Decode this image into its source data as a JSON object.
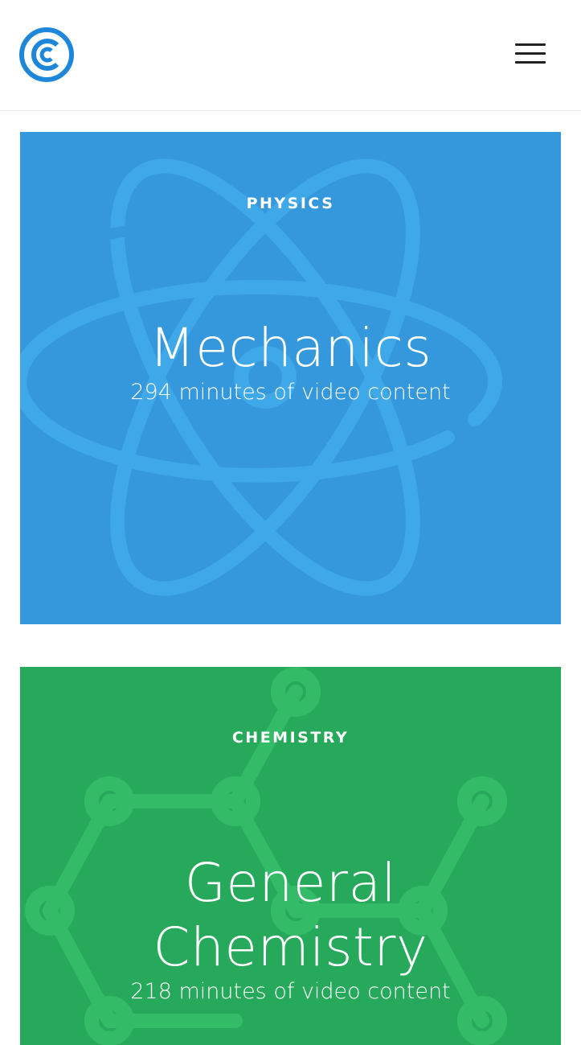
{
  "header": {
    "logo_icon": "c-logo-icon",
    "menu_icon": "hamburger-menu-icon"
  },
  "colors": {
    "brand_blue": "#1f87d9",
    "physics_bg": "#3698dc",
    "physics_art": "#3fa8e8",
    "chemistry_bg": "#27a95b",
    "chemistry_art": "#34bb67"
  },
  "courses": [
    {
      "category": "PHYSICS",
      "title": "Mechanics",
      "subtitle": "294 minutes of video content",
      "background_icon": "atom-icon"
    },
    {
      "category": "CHEMISTRY",
      "title_lines": [
        "General",
        "Chemistry"
      ],
      "subtitle": "218 minutes of video content",
      "background_icon": "molecule-icon"
    }
  ]
}
